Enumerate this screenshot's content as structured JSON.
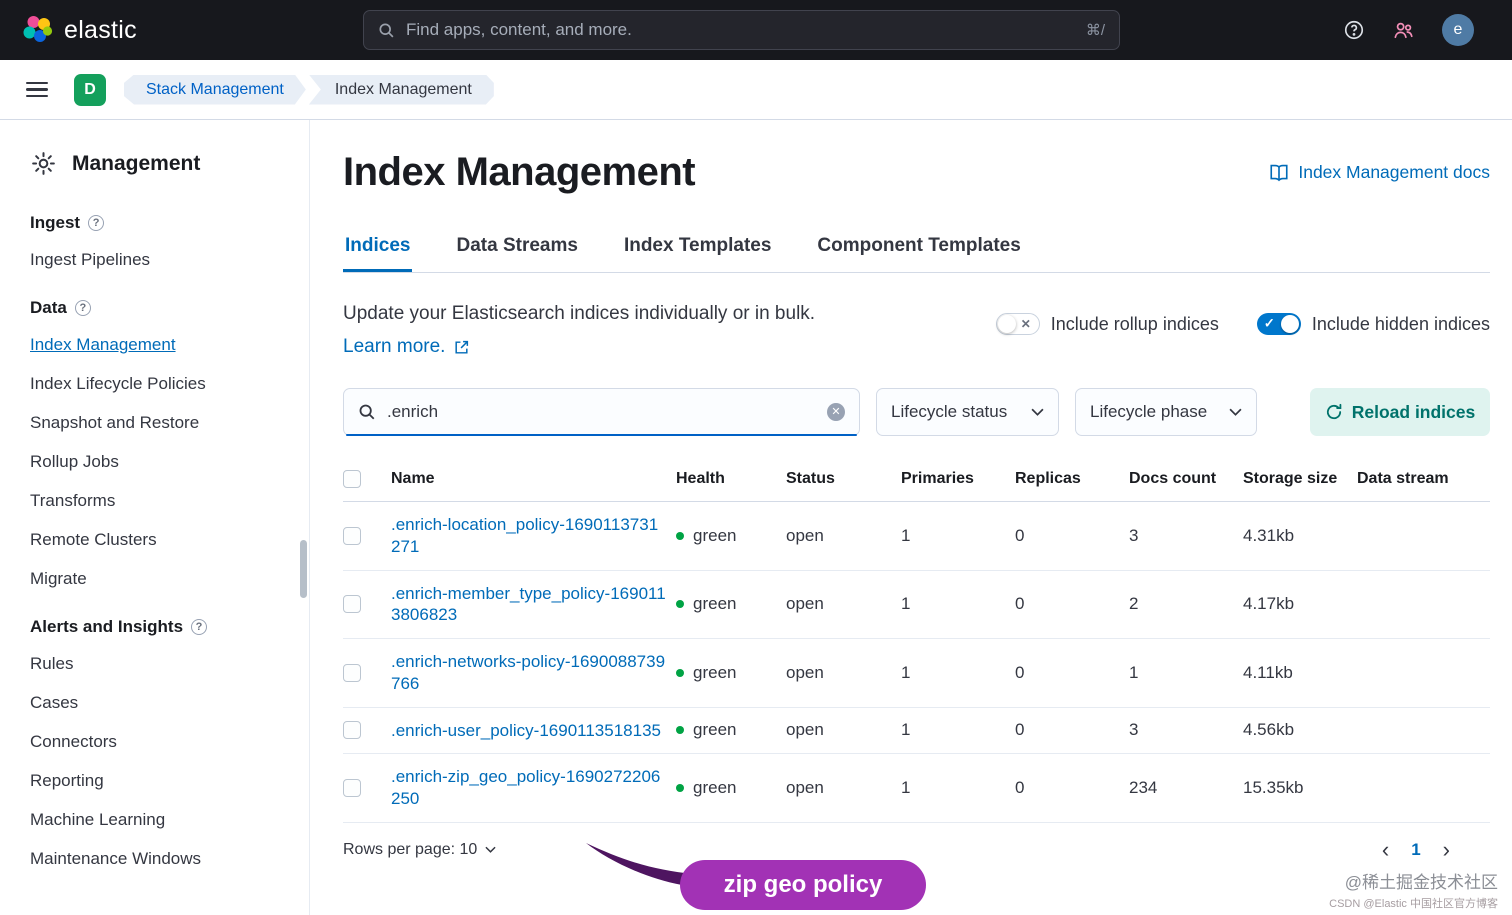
{
  "header": {
    "brand": "elastic",
    "search_placeholder": "Find apps, content, and more.",
    "search_shortcut": "⌘/",
    "avatar_initial": "e"
  },
  "breadcrumbs": {
    "space_badge": "D",
    "items": [
      {
        "label": "Stack Management"
      },
      {
        "label": "Index Management"
      }
    ]
  },
  "sidebar": {
    "title": "Management",
    "sections": [
      {
        "label": "Ingest",
        "items": [
          {
            "label": "Ingest Pipelines",
            "active": false
          }
        ]
      },
      {
        "label": "Data",
        "items": [
          {
            "label": "Index Management",
            "active": true
          },
          {
            "label": "Index Lifecycle Policies",
            "active": false
          },
          {
            "label": "Snapshot and Restore",
            "active": false
          },
          {
            "label": "Rollup Jobs",
            "active": false
          },
          {
            "label": "Transforms",
            "active": false
          },
          {
            "label": "Remote Clusters",
            "active": false
          },
          {
            "label": "Migrate",
            "active": false
          }
        ]
      },
      {
        "label": "Alerts and Insights",
        "items": [
          {
            "label": "Rules",
            "active": false
          },
          {
            "label": "Cases",
            "active": false
          },
          {
            "label": "Connectors",
            "active": false
          },
          {
            "label": "Reporting",
            "active": false
          },
          {
            "label": "Machine Learning",
            "active": false
          },
          {
            "label": "Maintenance Windows",
            "active": false
          }
        ]
      }
    ]
  },
  "main": {
    "title": "Index Management",
    "docs_link": "Index Management docs",
    "tabs": [
      {
        "label": "Indices",
        "active": true
      },
      {
        "label": "Data Streams",
        "active": false
      },
      {
        "label": "Index Templates",
        "active": false
      },
      {
        "label": "Component Templates",
        "active": false
      }
    ],
    "description": "Update your Elasticsearch indices individually or in bulk.",
    "learn_more": "Learn more.",
    "toggles": [
      {
        "label": "Include rollup indices",
        "on": false
      },
      {
        "label": "Include hidden indices",
        "on": true
      }
    ],
    "search": {
      "value": ".enrich"
    },
    "filters": [
      {
        "label": "Lifecycle status"
      },
      {
        "label": "Lifecycle phase"
      }
    ],
    "reload_button": "Reload indices",
    "table": {
      "columns": [
        "Name",
        "Health",
        "Status",
        "Primaries",
        "Replicas",
        "Docs count",
        "Storage size",
        "Data stream"
      ],
      "rows": [
        {
          "name": ".enrich-location_policy-1690113731271",
          "health": "green",
          "status": "open",
          "primaries": "1",
          "replicas": "0",
          "docs": "3",
          "storage": "4.31kb",
          "data_stream": ""
        },
        {
          "name": ".enrich-member_type_policy-1690113806823",
          "health": "green",
          "status": "open",
          "primaries": "1",
          "replicas": "0",
          "docs": "2",
          "storage": "4.17kb",
          "data_stream": ""
        },
        {
          "name": ".enrich-networks-policy-1690088739766",
          "health": "green",
          "status": "open",
          "primaries": "1",
          "replicas": "0",
          "docs": "1",
          "storage": "4.11kb",
          "data_stream": ""
        },
        {
          "name": ".enrich-user_policy-1690113518135",
          "health": "green",
          "status": "open",
          "primaries": "1",
          "replicas": "0",
          "docs": "3",
          "storage": "4.56kb",
          "data_stream": ""
        },
        {
          "name": ".enrich-zip_geo_policy-1690272206250",
          "health": "green",
          "status": "open",
          "primaries": "1",
          "replicas": "0",
          "docs": "234",
          "storage": "15.35kb",
          "data_stream": ""
        }
      ]
    },
    "rows_per_page_label": "Rows per page: 10",
    "pagination_page": "1",
    "annotation": "zip geo policy"
  },
  "watermark": {
    "line1": "@稀土掘金技术社区",
    "line2": "CSDN @Elastic 中国社区官方博客"
  },
  "colors": {
    "link_blue": "#006bb8",
    "toggle_on_blue": "#0077cc",
    "health_green": "#00a344",
    "annotation_purple": "#a232b5",
    "reload_teal": "#00726b",
    "space_badge_green": "#14a05c"
  }
}
